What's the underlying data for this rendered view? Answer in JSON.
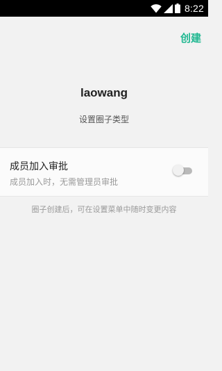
{
  "status_bar": {
    "time": "8:22",
    "icons": [
      "wifi-icon",
      "cell-signal-icon",
      "battery-icon"
    ]
  },
  "header": {
    "create_label": "创建"
  },
  "group": {
    "name": "laowang",
    "set_type_label": "设置圈子类型"
  },
  "settings": {
    "member_join_review": {
      "title": "成员加入审批",
      "description": "成员加入时，无需管理员审批",
      "enabled": false
    }
  },
  "footer": {
    "note": "圈子创建后，可在设置菜单中随时变更内容"
  },
  "colors": {
    "accent": "#22b892",
    "background": "#f2f2f2",
    "status_bar": "#000000"
  }
}
